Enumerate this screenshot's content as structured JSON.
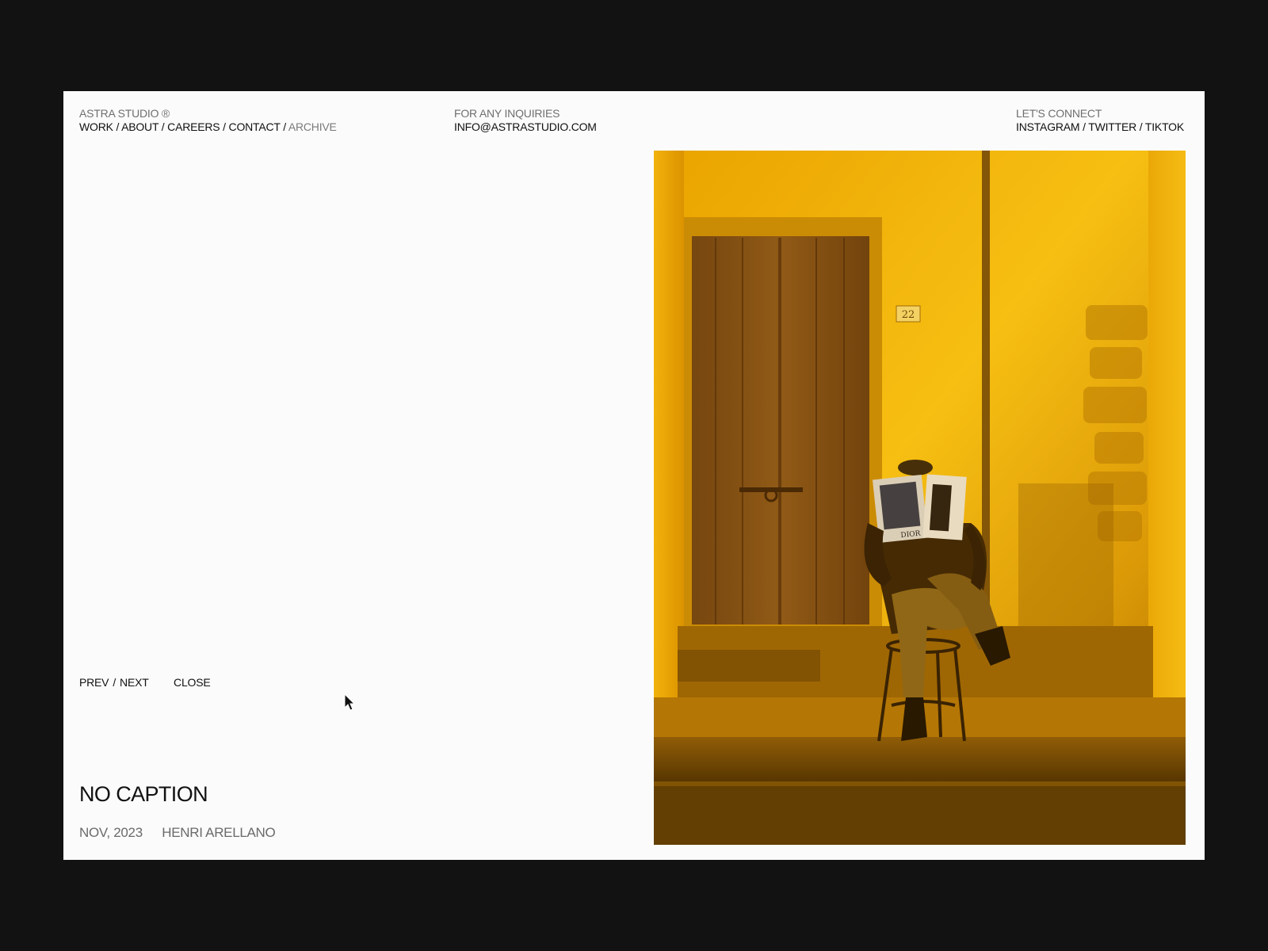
{
  "header": {
    "brand": "ASTRA STUDIO ®",
    "nav": [
      {
        "label": "WORK"
      },
      {
        "label": "ABOUT"
      },
      {
        "label": "CAREERS"
      },
      {
        "label": "CONTACT"
      },
      {
        "label": "ARCHIVE"
      }
    ],
    "nav_separator": "/",
    "inquiries_label": "FOR ANY INQUIRIES",
    "email": "INFO@ASTRASTUDIO.COM",
    "connect_label": "LET'S CONNECT",
    "social": [
      {
        "label": "INSTAGRAM"
      },
      {
        "label": "TWITTER"
      },
      {
        "label": "TIKTOK"
      }
    ]
  },
  "photo": {
    "alt": "Person seated on a chair on stone steps at night, reading a magazine, in warm amber light before a wooden door",
    "door_number": "22",
    "magazine_text": "DIOR"
  },
  "controls": {
    "prev": "PREV",
    "next": "NEXT",
    "close": "CLOSE"
  },
  "caption": {
    "title": "NO CAPTION",
    "date": "NOV, 2023",
    "author": "HENRI ARELLANO"
  },
  "colors": {
    "background": "#121212",
    "page": "#fbfbfb",
    "text": "#111111",
    "muted": "#6f6f6f"
  }
}
